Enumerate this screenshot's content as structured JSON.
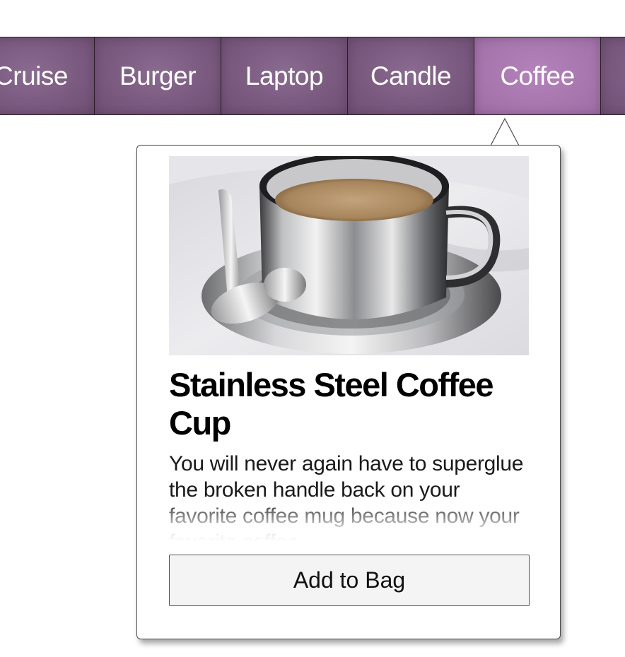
{
  "tabs": [
    {
      "label": "Cruise",
      "active": false
    },
    {
      "label": "Burger",
      "active": false
    },
    {
      "label": "Laptop",
      "active": false
    },
    {
      "label": "Candle",
      "active": false
    },
    {
      "label": "Coffee",
      "active": true
    },
    {
      "label": "",
      "active": false
    }
  ],
  "popover": {
    "image_icon": "coffee-cup-image",
    "title": "Stainless Steel Coffee Cup",
    "description": "You will never again have to superglue the broken handle back on your favorite coffee mug because now your favorite coffee",
    "add_button_label": "Add to Bag"
  },
  "colors": {
    "tab_bg": "#7b5a80",
    "tab_active_bg": "#a877ae",
    "tab_text": "#ffffff",
    "button_bg": "#f4f4f4"
  }
}
